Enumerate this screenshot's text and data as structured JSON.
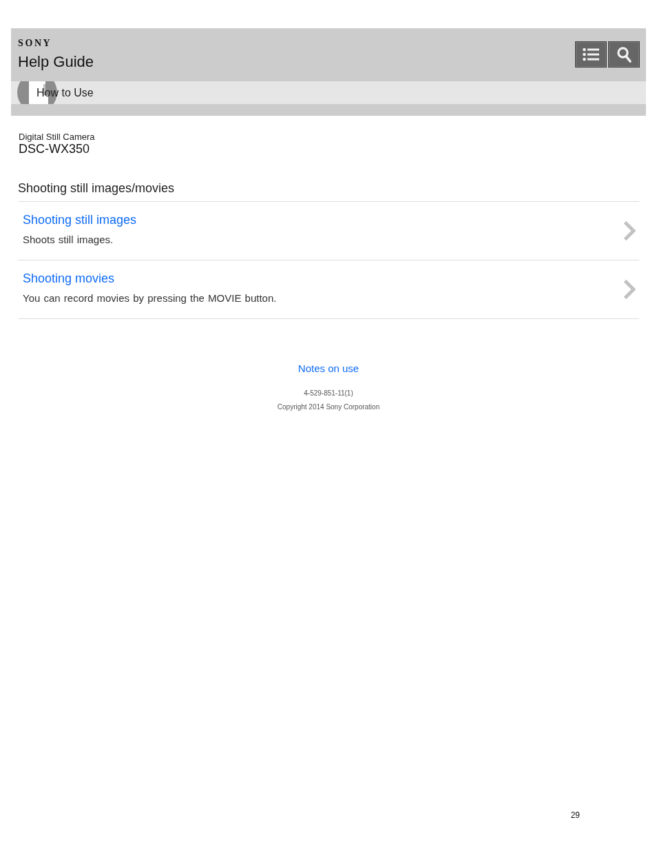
{
  "header": {
    "logo": "SONY",
    "title": "Help Guide",
    "buttons": [
      {
        "kind": "list"
      },
      {
        "kind": "search"
      }
    ]
  },
  "breadcrumb": {
    "label": "How to Use"
  },
  "product": {
    "category": "Digital Still Camera",
    "model": "DSC-WX350"
  },
  "section": {
    "title": "Shooting still images/movies",
    "items": [
      {
        "title": "Shooting still images",
        "description": "Shoots still images."
      },
      {
        "title": "Shooting movies",
        "description": "You can record movies by pressing the MOVIE button."
      }
    ]
  },
  "footer": {
    "link": "Notes on use",
    "code": "4-529-851-11(1)",
    "copyright": "Copyright 2014 Sony Corporation"
  },
  "page_number": "29"
}
